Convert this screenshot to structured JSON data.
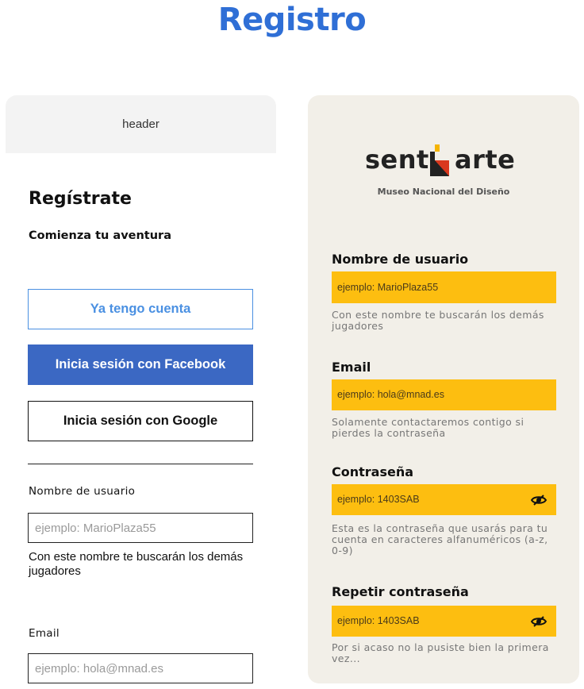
{
  "page": {
    "title": "Registro"
  },
  "left": {
    "header_label": "header",
    "heading": "Regístrate",
    "subheading": "Comienza tu aventura",
    "buttons": {
      "have_account": "Ya tengo cuenta",
      "facebook": "Inicia sesión con Facebook",
      "google": "Inicia sesión con Google"
    },
    "fields": {
      "username_label": "Nombre de usuario",
      "username_placeholder": "ejemplo: MarioPlaza55",
      "username_help": "Con este nombre te buscarán los demás jugadores",
      "email_label": "Email",
      "email_placeholder": "ejemplo: hola@mnad.es"
    },
    "colors": {
      "accent_blue": "#4a90e2",
      "facebook_blue": "#3b68c3"
    }
  },
  "right": {
    "logo": {
      "left": "sent",
      "right": "arte",
      "caption": "Museo Nacional del Diseño"
    },
    "fields": [
      {
        "label": "Nombre de usuario",
        "placeholder": "ejemplo: MarioPlaza55",
        "help": "Con este nombre te buscarán los demás jugadores",
        "icon": ""
      },
      {
        "label": "Email",
        "placeholder": "ejemplo: hola@mnad.es",
        "help": "Solamente contactaremos contigo si pierdes la contraseña",
        "icon": ""
      },
      {
        "label": "Contraseña",
        "placeholder": "ejemplo: 1403SAB",
        "help": "Esta es la contraseña que usarás para tu cuenta en caracteres alfanuméricos (a-z, 0-9)",
        "icon": "eye-icon"
      },
      {
        "label": "Repetir contraseña",
        "placeholder": "ejemplo: 1403SAB",
        "help": "Por si acaso no la pusiste bien la primera vez...",
        "icon": "eye-icon"
      }
    ],
    "colors": {
      "panel_bg": "#f2efe8",
      "field_bg": "#fdbe10"
    }
  }
}
